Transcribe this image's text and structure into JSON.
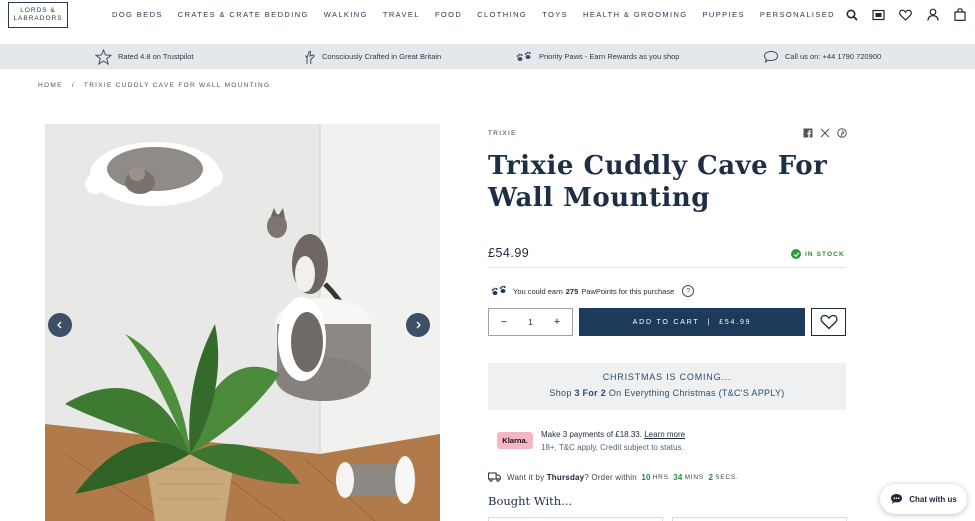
{
  "header": {
    "logo_line1": "LORDS &",
    "logo_line2": "LABRADORS",
    "nav": [
      "DOG BEDS",
      "CRATES & CRATE BEDDING",
      "WALKING",
      "TRAVEL",
      "FOOD",
      "CLOTHING",
      "TOYS",
      "HEALTH & GROOMING",
      "PUPPIES",
      "PERSONALISED"
    ],
    "icons": [
      "search-icon",
      "gift-card-icon",
      "heart-icon",
      "account-icon",
      "bag-icon"
    ]
  },
  "usp": {
    "trustpilot": "Rated 4.8 on Trustpilot",
    "crafted": "Consciously Crafted in Great Britain",
    "rewards": "Priority Paws - Earn Rewards as you shop",
    "call": "Call us on: +44 1790 720900"
  },
  "breadcrumb": {
    "home": "HOME",
    "separator": "/",
    "current": "TRIXIE CUDDLY CAVE FOR WALL MOUNTING"
  },
  "product": {
    "brand": "TRIXIE",
    "title": "Trixie Cuddly Cave For Wall Mounting",
    "price": "£54.99",
    "stock": "IN STOCK",
    "pawpoints_prefix": "You could earn",
    "pawpoints_value": "275",
    "pawpoints_suffix": "PawPoints for this purchase",
    "help": "?",
    "quantity": "1",
    "minus": "−",
    "plus": "+",
    "add_to_cart": "ADD TO CART",
    "cart_sep": "|",
    "cart_price": "£54.99"
  },
  "promo": {
    "title": "CHRISTMAS IS COMING...",
    "sub_prefix": "Shop",
    "sub_bold": "3 For 2",
    "sub_suffix": "On Everything Christmas (T&C'S APPLY)"
  },
  "klarna": {
    "logo": "Klarna.",
    "line1": "Make 3 payments of £18.33.",
    "learn_more": "Learn more",
    "line2": "18+, T&C apply, Credit subject to status."
  },
  "delivery": {
    "prefix": "Want it by",
    "day": "Thursday",
    "mid": "? Order within",
    "hours": "10",
    "hrs_label": "HRS",
    "mins": "34",
    "mins_label": "MINS",
    "secs": "2",
    "secs_label": "SECS."
  },
  "bought_with": "Bought With...",
  "chat": "Chat with us",
  "colors": {
    "navy": "#1d3a5a",
    "usp_bg": "#e5e8eb",
    "stock_green": "#2b8a3e",
    "klarna_pink": "#f4b6c4"
  }
}
